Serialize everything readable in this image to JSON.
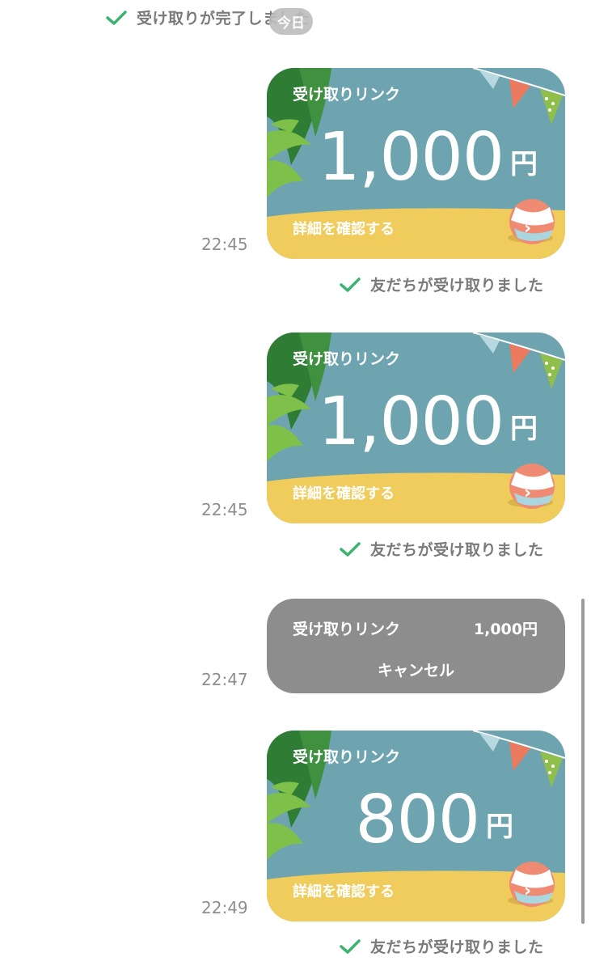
{
  "top_status": {
    "text": "受け取りが完了しました",
    "date_pill": "今日"
  },
  "messages": [
    {
      "type": "link",
      "time": "22:45",
      "title": "受け取りリンク",
      "amount": "1,000",
      "currency": "円",
      "detail": "詳細を確認する",
      "status": "友だちが受け取りました"
    },
    {
      "type": "link",
      "time": "22:45",
      "title": "受け取りリンク",
      "amount": "1,000",
      "currency": "円",
      "detail": "詳細を確認する",
      "status": "友だちが受け取りました"
    },
    {
      "type": "cancelled",
      "time": "22:47",
      "title": "受け取りリンク",
      "amount": "1,000円",
      "cancel_label": "キャンセル"
    },
    {
      "type": "link",
      "time": "22:49",
      "title": "受け取りリンク",
      "amount": "800",
      "currency": "円",
      "detail": "詳細を確認する",
      "status": "友だちが受け取りました"
    }
  ],
  "icons": {
    "check": "check-icon",
    "chevron": "chevron-right-icon",
    "ball": "beach-ball-icon",
    "palm": "palm-leaf-icon",
    "flags": "bunting-flags-icon"
  },
  "colors": {
    "sky": "#6ea4b0",
    "sand": "#f0cc5c",
    "check_green": "#3cb371",
    "cancel_gray": "#8d8d8d"
  }
}
